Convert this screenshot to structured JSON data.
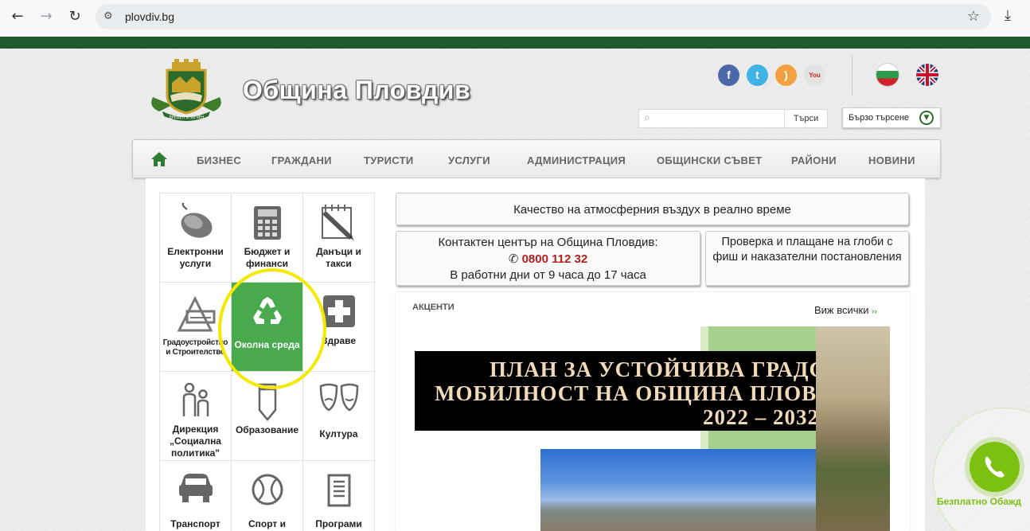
{
  "browser": {
    "url": "plovdiv.bg"
  },
  "header": {
    "site_title": "Община Пловдив",
    "crest_motto": "ДРЕВЕН И ВЕЧЕН",
    "search_placeholder": "",
    "search_button": "Търси",
    "quick_search": "Бързо търсене",
    "social": [
      "facebook",
      "twitter",
      "rss",
      "youtube"
    ],
    "languages": [
      "bg",
      "en"
    ]
  },
  "menu": {
    "items": [
      "БИЗНЕС",
      "ГРАЖДАНИ",
      "ТУРИСТИ",
      "УСЛУГИ",
      "АДМИНИСТРАЦИЯ",
      "ОБЩИНСКИ СЪВЕТ",
      "РАЙОНИ",
      "НОВИНИ"
    ]
  },
  "tiles": [
    {
      "label": "Електронни услуги",
      "icon": "mouse-icon"
    },
    {
      "label": "Бюджет и финанси",
      "icon": "calculator-icon"
    },
    {
      "label": "Данъци и такси",
      "icon": "notepad-pencil-icon"
    },
    {
      "label": "Градоустройство и Строителство",
      "icon": "drafting-tools-icon"
    },
    {
      "label": "Околна среда",
      "icon": "recycle-icon",
      "active": true
    },
    {
      "label": "Здраве",
      "icon": "health-cross-icon"
    },
    {
      "label": "Дирекция „Социална политика\"",
      "icon": "people-icon"
    },
    {
      "label": "Образование",
      "icon": "pencil-icon"
    },
    {
      "label": "Култура",
      "icon": "theatre-masks-icon"
    },
    {
      "label": "Транспорт",
      "icon": "car-icon"
    },
    {
      "label": "Спорт и",
      "icon": "ball-icon"
    },
    {
      "label": "Програми",
      "icon": "document-icon"
    }
  ],
  "info": {
    "air_quality": "Качество на атмосферния въздух в реално време",
    "contact_line1": "Контактен център на Община Пловдив:",
    "contact_phone": "0800 112 32",
    "contact_hours": "В работни дни от 9 часа до 17 часа",
    "fines": "Проверка и плащане на глоби с фиш и наказателни постановления"
  },
  "accents": {
    "title": "АКЦЕНТИ",
    "see_all": "Виж всички",
    "slide_line1": "ПЛАН ЗА УСТОЙЧИВА ГРАДСК",
    "slide_line2": "МОБИЛНОСТ НА ОБЩИНА ПЛОВДИ",
    "slide_line3": "2022 – 2032 I"
  },
  "call_widget": {
    "label": "Безплатно Обажд"
  },
  "colors": {
    "brand_green": "#1f5a2a",
    "tile_active": "#48aa4d",
    "phone_red": "#b31f1f",
    "call_green": "#7cc012",
    "highlight_ring": "#f3ea00"
  }
}
